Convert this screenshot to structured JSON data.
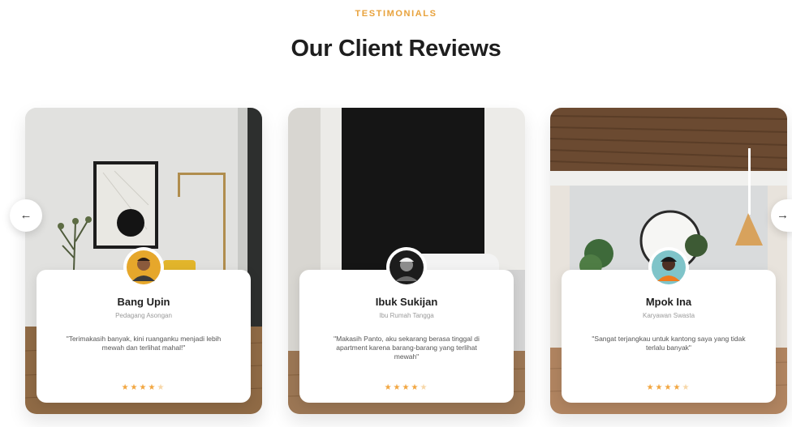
{
  "section": {
    "eyebrow": "TESTIMONIALS",
    "title": "Our Client Reviews"
  },
  "nav": {
    "prev_icon": "arrow-left-icon",
    "prev_glyph": "←",
    "next_icon": "arrow-right-icon",
    "next_glyph": "→"
  },
  "reviews": [
    {
      "name": "Bang Upin",
      "role": "Pedagang Asongan",
      "quote": "\"Terimakasih banyak, kini ruanganku menjadi lebih mewah dan terlihat mahal!\"",
      "rating": 4,
      "max_rating": 5
    },
    {
      "name": "Ibuk Sukijan",
      "role": "Ibu Rumah Tangga",
      "quote": "\"Makasih Panto, aku sekarang berasa tinggal di apartment karena barang-barang yang terlihat mewah\"",
      "rating": 4,
      "max_rating": 5
    },
    {
      "name": "Mpok Ina",
      "role": "Karyawan Swasta",
      "quote": "\"Sangat terjangkau untuk kantong saya yang tidak terlalu banyak\"",
      "rating": 4,
      "max_rating": 5
    }
  ],
  "colors": {
    "accent": "#e8a23c",
    "star_on": "#f2a640",
    "star_off": "#f7d7a8"
  }
}
